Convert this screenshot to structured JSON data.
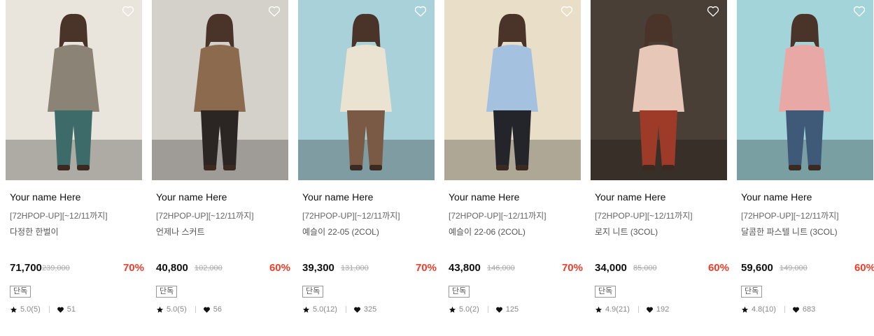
{
  "products": [
    {
      "brand": "Your name Here",
      "promo": "[72HPOP-UP][~12/11까지]",
      "name": "다정한 한벌이",
      "price": "71,700",
      "original_price": "239,000",
      "discount": "70%",
      "badge": "단독",
      "rating": "5.0(5)",
      "likes": "51",
      "bg": "#e9e4dc",
      "figure": "#8a8376",
      "accent": "#3d6b6a"
    },
    {
      "brand": "Your name Here",
      "promo": "[72HPOP-UP][~12/11까지]",
      "name": "언제나 스커트",
      "price": "40,800",
      "original_price": "102,000",
      "discount": "60%",
      "badge": "단독",
      "rating": "5.0(5)",
      "likes": "56",
      "bg": "#d4d1cb",
      "figure": "#8c6a4e",
      "accent": "#2b2624"
    },
    {
      "brand": "Your name Here",
      "promo": "[72HPOP-UP][~12/11까지]",
      "name": "예슬이 22-05 (2COL)",
      "price": "39,300",
      "original_price": "131,000",
      "discount": "70%",
      "badge": "단독",
      "rating": "5.0(12)",
      "likes": "325",
      "bg": "#a8d1d9",
      "figure": "#ebe3d2",
      "accent": "#7a5a44"
    },
    {
      "brand": "Your name Here",
      "promo": "[72HPOP-UP][~12/11까지]",
      "name": "예슬이 22-06 (2COL)",
      "price": "43,800",
      "original_price": "146,000",
      "discount": "70%",
      "badge": "단독",
      "rating": "5.0(2)",
      "likes": "125",
      "bg": "#e9dfc8",
      "figure": "#a5c1e0",
      "accent": "#23252b"
    },
    {
      "brand": "Your name Here",
      "promo": "[72HPOP-UP][~12/11까지]",
      "name": "로지 니트 (3COL)",
      "price": "34,000",
      "original_price": "85,000",
      "discount": "60%",
      "badge": "단독",
      "rating": "4.9(21)",
      "likes": "192",
      "bg": "#4a3f36",
      "figure": "#e6c7b8",
      "accent": "#9d3a28"
    },
    {
      "brand": "Your name Here",
      "promo": "[72HPOP-UP][~12/11까지]",
      "name": "달콤한 파스텔 니트 (3COL)",
      "price": "59,600",
      "original_price": "149,000",
      "discount": "60%",
      "badge": "단독",
      "rating": "4.8(10)",
      "likes": "683",
      "bg": "#a3d4d9",
      "figure": "#e8a9a6",
      "accent": "#3e5a78"
    }
  ]
}
